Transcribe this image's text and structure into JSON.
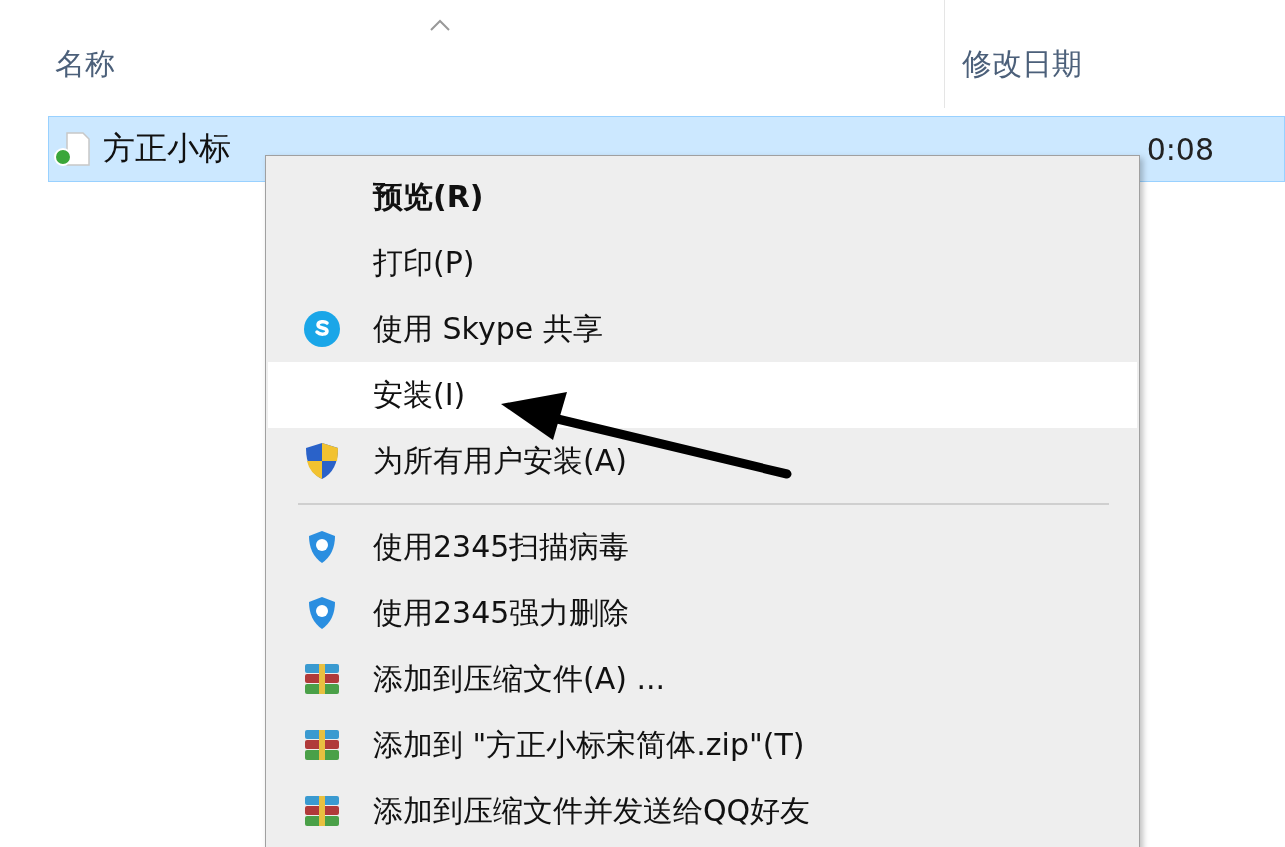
{
  "columns": [
    {
      "label": "名称",
      "sorted": true
    },
    {
      "label": "修改日期"
    }
  ],
  "file": {
    "name": "方正小标",
    "date": "0:08",
    "selected": true,
    "synced": true
  },
  "context_menu": {
    "items": [
      {
        "kind": "plain",
        "label": "预览(R)",
        "default": true,
        "selected": false
      },
      {
        "kind": "plain",
        "label": "打印(P)",
        "default": false,
        "selected": false
      },
      {
        "kind": "skype",
        "label": "使用 Skype 共享",
        "default": false,
        "selected": false
      },
      {
        "kind": "plain",
        "label": "安装(I)",
        "default": false,
        "selected": true
      },
      {
        "kind": "shield",
        "label": "为所有用户安装(A)",
        "default": false,
        "selected": false
      },
      {
        "kind": "separator"
      },
      {
        "kind": "guard",
        "label": "使用2345扫描病毒",
        "default": false,
        "selected": false
      },
      {
        "kind": "guard",
        "label": "使用2345强力删除",
        "default": false,
        "selected": false
      },
      {
        "kind": "archive",
        "label": "添加到压缩文件(A) ...",
        "default": false,
        "selected": false
      },
      {
        "kind": "archive",
        "label": "添加到 \"方正小标宋简体.zip\"(T)",
        "default": false,
        "selected": false
      },
      {
        "kind": "archive",
        "label": "添加到压缩文件并发送给QQ好友",
        "default": false,
        "selected": false
      }
    ]
  }
}
